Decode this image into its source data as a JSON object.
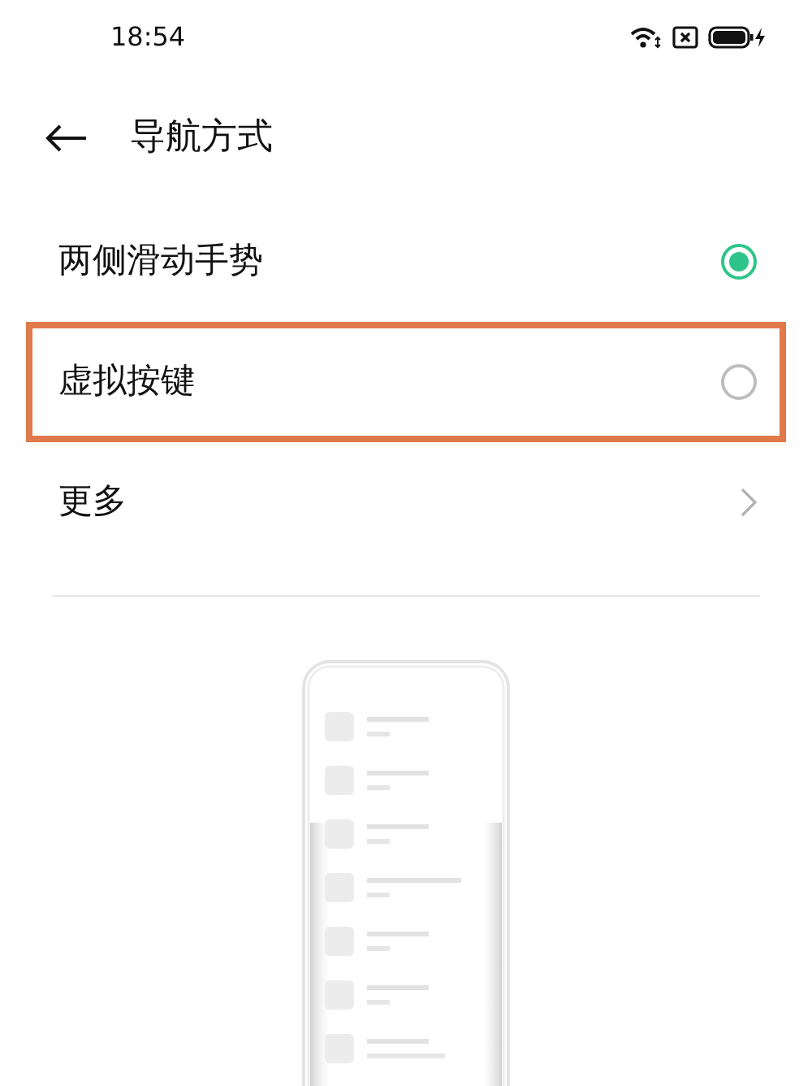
{
  "status_bar": {
    "time": "18:54"
  },
  "header": {
    "title": "导航方式"
  },
  "options": [
    {
      "kind": "radio",
      "label": "两侧滑动手势",
      "selected": true,
      "highlighted": false
    },
    {
      "kind": "radio",
      "label": "虚拟按键",
      "selected": false,
      "highlighted": true
    },
    {
      "kind": "link",
      "label": "更多",
      "highlighted": false
    }
  ]
}
